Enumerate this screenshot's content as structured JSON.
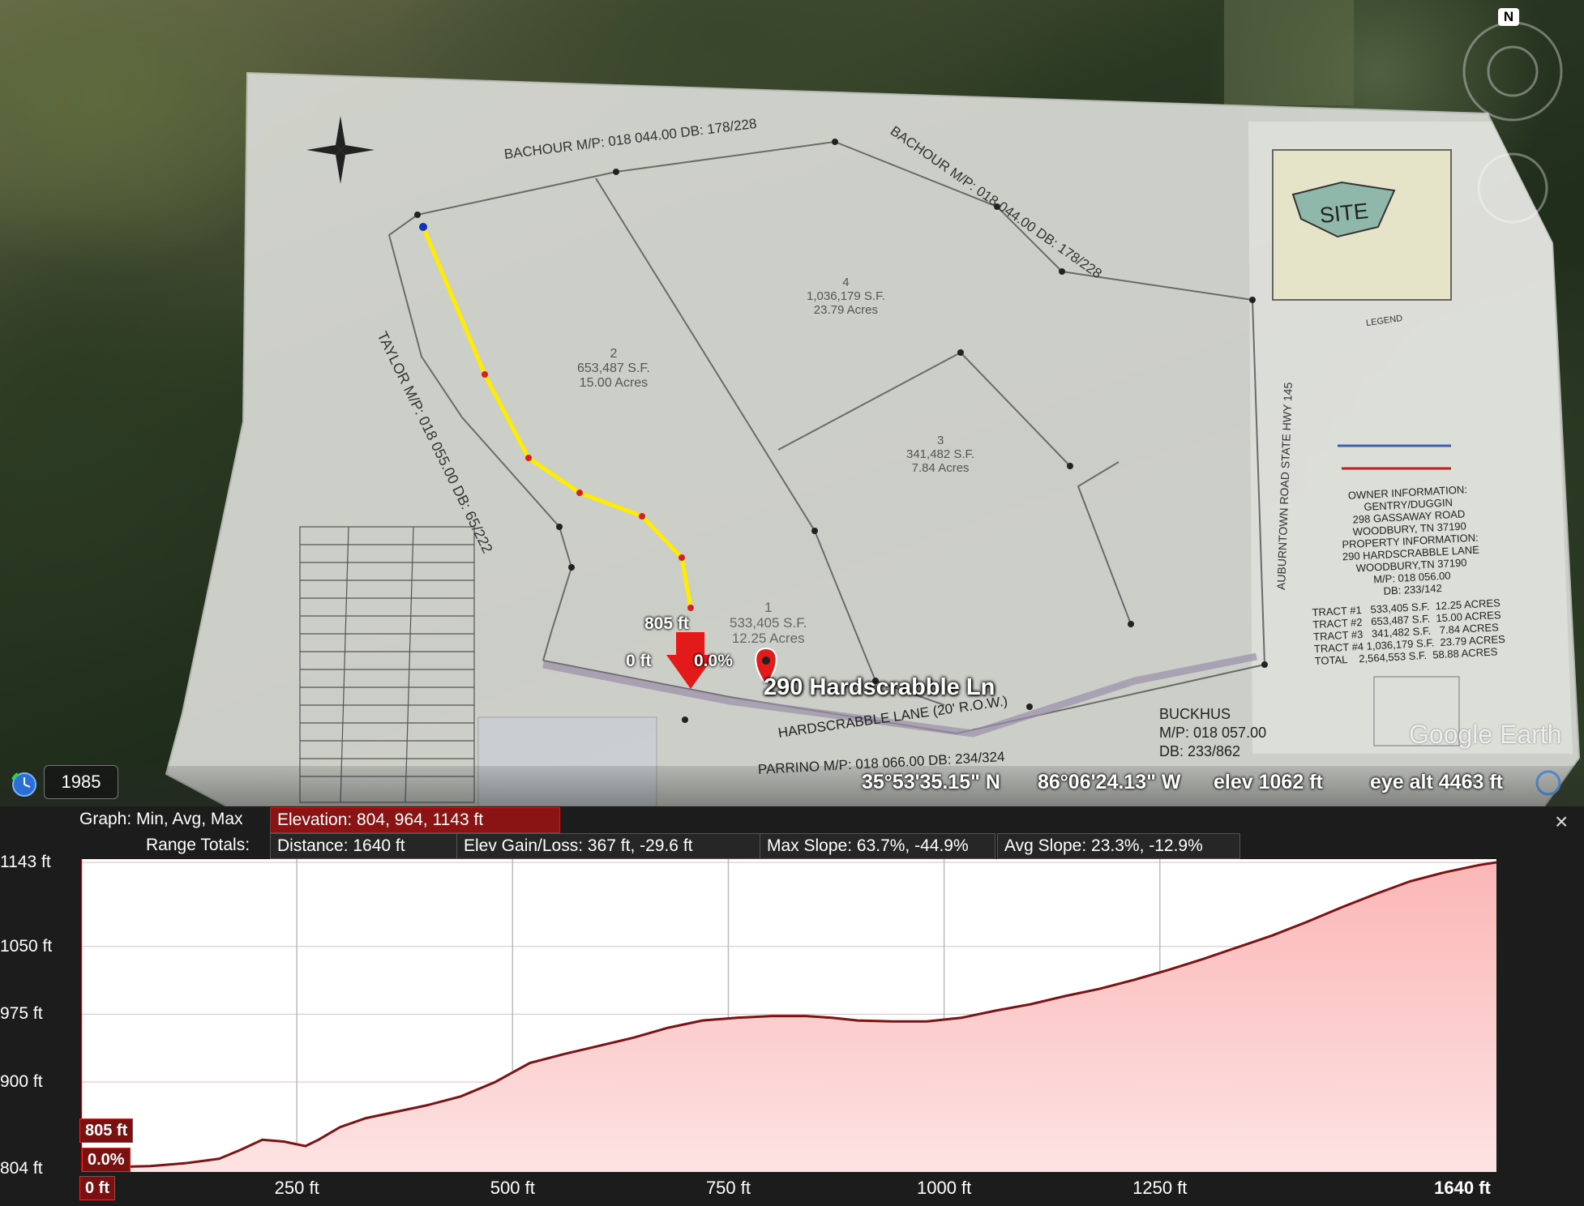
{
  "map": {
    "place_label": "290 Hardscrabble Ln",
    "north_label": "N",
    "cursor_marker": {
      "elevation": "805 ft",
      "distance": "0 ft",
      "slope": "0.0%"
    },
    "survey": {
      "title_north_left": "BACHOUR M/P: 018 044.00 DB: 178/228",
      "title_north_right": "BACHOUR M/P: 018 044.00 DB: 178/228",
      "taylor": "TAYLOR M/P: 018 055.00 DB: 65/222",
      "hardscrabble": "HARDSCRABBLE LANE (20' R.O.W.)",
      "parrino": "PARRINO M/P: 018 066.00 DB: 234/324",
      "auburntown": "AUBURNTOWN ROAD STATE HWY 145",
      "buckhus": [
        "BUCKHUS",
        "M/P: 018 057.00",
        "DB: 233/862"
      ],
      "site_label": "SITE",
      "legend_title": "LEGEND",
      "tracts": [
        {
          "num": "1",
          "sf": "533,405 S.F.",
          "acres": "12.25 Acres"
        },
        {
          "num": "2",
          "sf": "653,487 S.F.",
          "acres": "15.00 Acres"
        },
        {
          "num": "3",
          "sf": "341,482 S.F.",
          "acres": "7.84 Acres"
        },
        {
          "num": "4",
          "sf": "1,036,179 S.F.",
          "acres": "23.79 Acres"
        }
      ],
      "owner_info": [
        "OWNER INFORMATION:",
        "GENTRY/DUGGIN",
        "298 GASSAWAY ROAD",
        "WOODBURY, TN 37190",
        "PROPERTY INFORMATION:",
        "290 HARDSCRABBLE LANE",
        "WOODBURY,TN 37190",
        "M/P: 018 056.00",
        "DB: 233/142"
      ],
      "tract_summary": [
        "TRACT #1   533,405 S.F.  12.25 ACRES",
        "TRACT #2   653,487 S.F.  15.00 ACRES",
        "TRACT #3   341,482 S.F.   7.84 ACRES",
        "TRACT #4 1,036,179 S.F.  23.79 ACRES",
        "TOTAL    2,564,553 S.F.  58.88 ACRES"
      ]
    },
    "status": {
      "year": "1985",
      "lat": "35°53'35.15\" N",
      "lon": "86°06'24.13\" W",
      "elev": "elev  1062 ft",
      "eye_alt": "eye alt  4463 ft"
    },
    "logo": "Google Earth"
  },
  "panel": {
    "graph_label": "Graph: Min, Avg, Max",
    "graph_value": "Elevation: 804, 964, 1143 ft",
    "range_label": "Range Totals:",
    "distance": "Distance: 1640 ft",
    "elev_gain_loss": "Elev Gain/Loss: 367 ft, -29.6 ft",
    "max_slope": "Max Slope: 63.7%, -44.9%",
    "avg_slope": "Avg Slope: 23.3%, -12.9%",
    "close": "×",
    "start_elev_tag": "805 ft",
    "start_slope_tag": "0.0%",
    "start_dist_tag": "0 ft",
    "end_dist_tag": "1640 ft",
    "y_ticks": [
      "1143 ft",
      "1050 ft",
      "975 ft",
      "900 ft",
      "804 ft"
    ],
    "x_ticks": [
      "250 ft",
      "500 ft",
      "750 ft",
      "1000 ft",
      "1250 ft"
    ]
  },
  "chart_data": {
    "type": "area",
    "xlabel": "",
    "ylabel": "",
    "xlim": [
      0,
      1640
    ],
    "ylim": [
      804,
      1143
    ],
    "y_ticks": [
      804,
      900,
      975,
      1050,
      1143
    ],
    "x_ticks": [
      0,
      250,
      500,
      750,
      1000,
      1250,
      1640
    ],
    "grid": true,
    "series": [
      {
        "x": [
          0,
          40,
          80,
          120,
          160,
          185,
          210,
          235,
          260,
          275,
          300,
          330,
          360,
          400,
          440,
          480,
          520,
          560,
          600,
          640,
          680,
          720,
          760,
          800,
          840,
          870,
          900,
          940,
          980,
          1000,
          1020,
          1060,
          1100,
          1140,
          1180,
          1220,
          1260,
          1300,
          1340,
          1380,
          1420,
          1460,
          1500,
          1540,
          1580,
          1620,
          1640
        ],
        "y": [
          805,
          806,
          807,
          810,
          815,
          825,
          836,
          834,
          829,
          836,
          850,
          860,
          866,
          874,
          884,
          900,
          921,
          931,
          940,
          949,
          960,
          968,
          971,
          973,
          973,
          971,
          968,
          967,
          967,
          969,
          971,
          979,
          986,
          995,
          1003,
          1013,
          1024,
          1036,
          1049,
          1062,
          1077,
          1093,
          1108,
          1122,
          1132,
          1140,
          1143
        ]
      }
    ]
  }
}
